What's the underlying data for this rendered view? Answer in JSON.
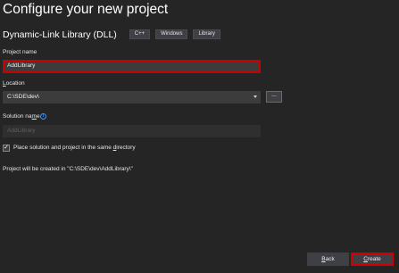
{
  "title": "Configure your new project",
  "template": {
    "name": "Dynamic-Link Library (DLL)",
    "tags": [
      "C++",
      "Windows",
      "Library"
    ]
  },
  "project_name": {
    "label": "Project name",
    "value": "AddLibrary"
  },
  "location": {
    "label": "Location",
    "value": "C:\\SDE\\dev\\",
    "browse_label": "..."
  },
  "solution_name": {
    "label": "Solution name",
    "placeholder": "AddLibrary",
    "info_icon": "info-icon"
  },
  "same_directory": {
    "checked": true,
    "label": "Place solution and project in the same directory"
  },
  "summary": "Project will be created in \"C:\\SDE\\dev\\AddLibrary\\\"",
  "buttons": {
    "back": "Back",
    "create": "Create"
  },
  "colors": {
    "background": "#252526",
    "highlight": "#c80000",
    "info": "#3794ff"
  }
}
